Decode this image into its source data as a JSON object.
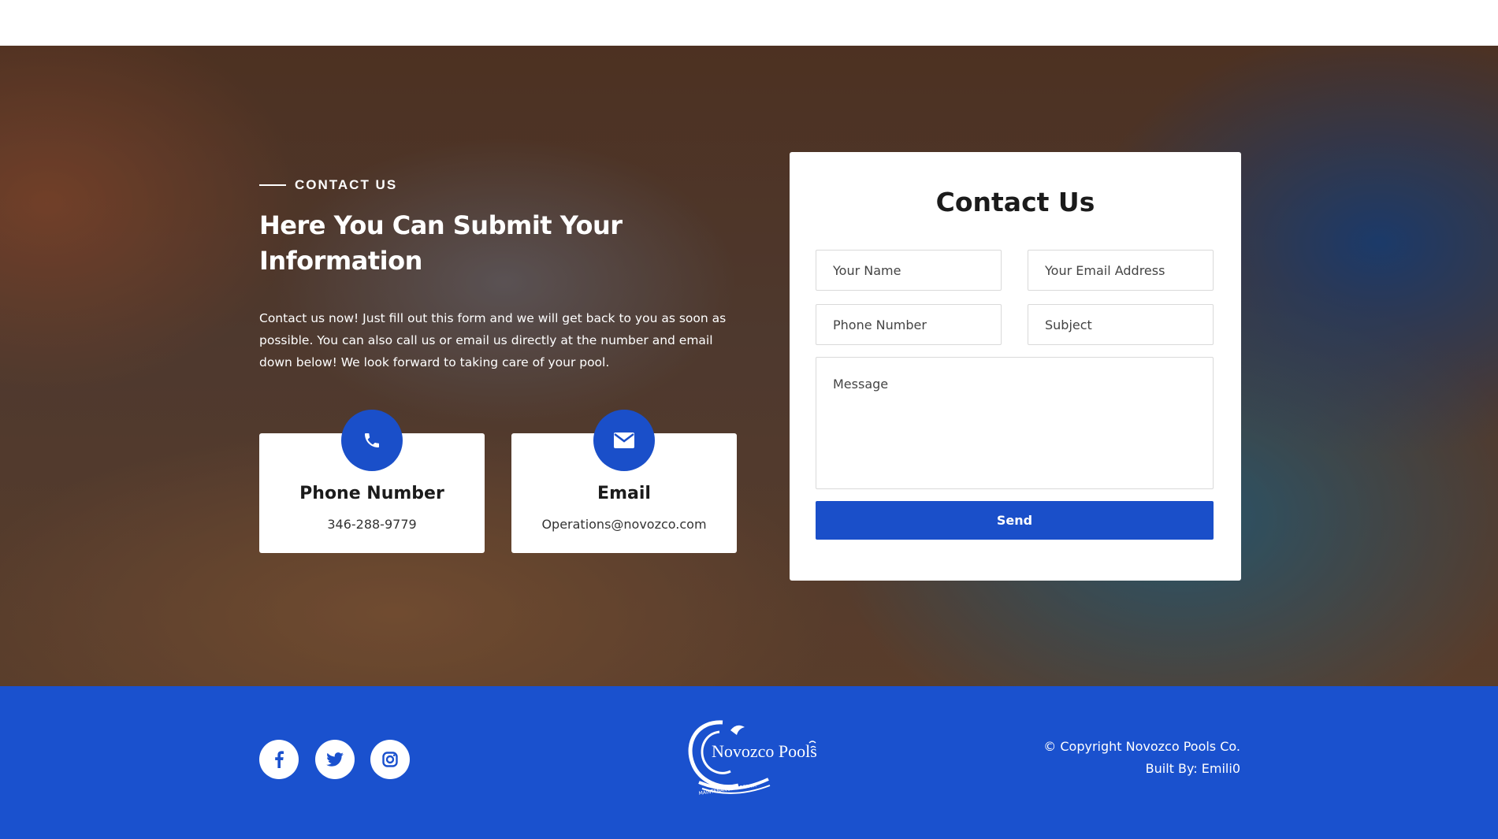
{
  "hero": {
    "tagline": "CONTACT US",
    "headline": "Here You Can Submit Your Information",
    "intro": "Contact us now! Just fill out this form and we will get back to you as soon as possible. You can also call us or email us directly at the number and email down below! We look forward to taking care of your pool.",
    "cards": [
      {
        "title": "Phone Number",
        "value": "346-288-9779",
        "icon": "phone-icon"
      },
      {
        "title": "Email",
        "value": "Operations@novozco.com",
        "icon": "envelope-icon"
      }
    ]
  },
  "form": {
    "title": "Contact Us",
    "name_placeholder": "Your Name",
    "email_placeholder": "Your Email Address",
    "phone_placeholder": "Phone Number",
    "subject_placeholder": "Subject",
    "message_placeholder": "Message",
    "send_label": "Send"
  },
  "footer": {
    "social": [
      "facebook-icon",
      "twitter-icon",
      "instagram-icon"
    ],
    "logo_text": "Novozco Pools",
    "logo_subtext": "MAINTENANCE & REPAIR",
    "copyright": "© Copyright Novozco Pools Co.",
    "built_by": "Built By: Emili0"
  },
  "colors": {
    "primary": "#1a4fc9",
    "footer": "#1a51ce",
    "text_dark": "#1b1b1b",
    "white": "#ffffff"
  }
}
